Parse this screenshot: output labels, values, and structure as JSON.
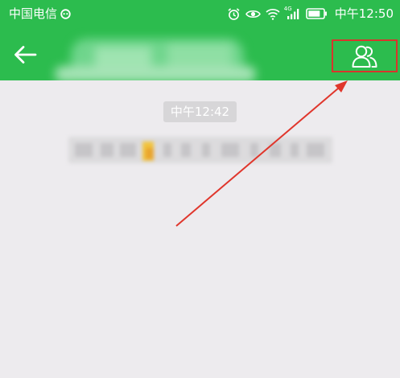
{
  "status_bar": {
    "carrier": "中国电信",
    "time": "中午12:50",
    "network_label": "4G"
  },
  "nav_bar": {
    "back_icon": "arrow-left-icon",
    "group_icon": "group-members-icon"
  },
  "chat": {
    "timestamp": "中午12:42"
  },
  "colors": {
    "header_green": "#2cbc4e",
    "chat_background": "#edebee",
    "highlight_red": "#d9352c"
  }
}
